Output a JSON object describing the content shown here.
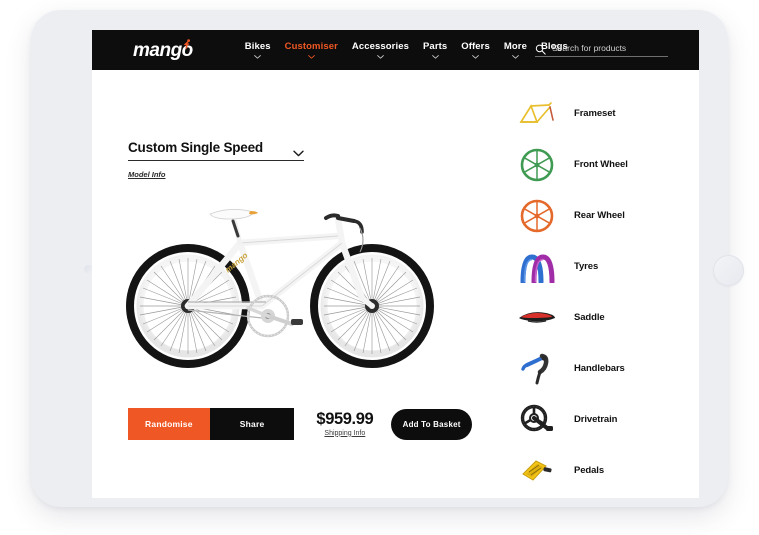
{
  "brand": {
    "logo_text": "mango",
    "logo_icon": "cyclist-icon",
    "accent_color": "#ef5724",
    "dark_color": "#0d0d0d"
  },
  "nav": {
    "items": [
      {
        "label": "Bikes",
        "active": false,
        "has_dropdown": true
      },
      {
        "label": "Customiser",
        "active": true,
        "has_dropdown": true
      },
      {
        "label": "Accessories",
        "active": false,
        "has_dropdown": true
      },
      {
        "label": "Parts",
        "active": false,
        "has_dropdown": true
      },
      {
        "label": "Offers",
        "active": false,
        "has_dropdown": true
      },
      {
        "label": "More",
        "active": false,
        "has_dropdown": true
      },
      {
        "label": "Blogs",
        "active": false,
        "has_dropdown": false
      }
    ]
  },
  "search": {
    "placeholder": "Search for products",
    "value": "",
    "icon": "search-icon"
  },
  "model": {
    "title": "Custom Single Speed",
    "caret_icon": "chevron-down-icon",
    "info_link": "Model Info"
  },
  "product": {
    "image_alt": "white single speed bicycle",
    "decal_text": "mango"
  },
  "actions": {
    "randomise_label": "Randomise",
    "share_label": "Share",
    "price": "$959.99",
    "shipping_link": "Shipping Info",
    "add_to_basket_label": "Add To Basket"
  },
  "components": [
    {
      "label": "Frameset",
      "icon": "frameset-icon",
      "color": "#e8bf2e"
    },
    {
      "label": "Front Wheel",
      "icon": "wheel-icon",
      "color": "#3f9a52"
    },
    {
      "label": "Rear Wheel",
      "icon": "wheel-icon",
      "color": "#e4692a"
    },
    {
      "label": "Tyres",
      "icon": "tyres-icon",
      "color": "#2f6fd0"
    },
    {
      "label": "Saddle",
      "icon": "saddle-icon",
      "color": "#d8302a"
    },
    {
      "label": "Handlebars",
      "icon": "handlebars-icon",
      "color": "#2f6fd0"
    },
    {
      "label": "Drivetrain",
      "icon": "drivetrain-icon",
      "color": "#222222"
    },
    {
      "label": "Pedals",
      "icon": "pedals-icon",
      "color": "#f2c516"
    }
  ],
  "device": {
    "type": "tablet",
    "home_button": "home-button",
    "camera": "front-camera"
  }
}
